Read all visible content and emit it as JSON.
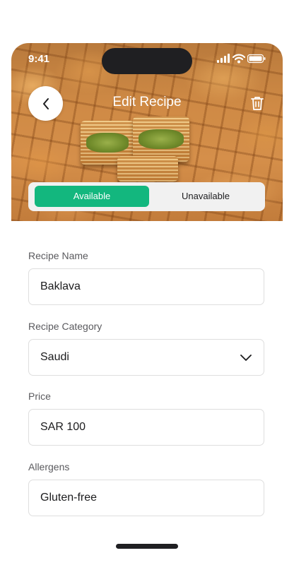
{
  "status_bar": {
    "time": "9:41"
  },
  "header": {
    "title": "Edit Recipe"
  },
  "availability": {
    "options": [
      "Available",
      "Unavailable"
    ],
    "selected": "Available",
    "accent_color": "#13b77e"
  },
  "form": {
    "recipe_name": {
      "label": "Recipe Name",
      "value": "Baklava"
    },
    "recipe_category": {
      "label": "Recipe Category",
      "value": "Saudi"
    },
    "price": {
      "label": "Price",
      "value": "SAR 100"
    },
    "allergens": {
      "label": "Allergens",
      "value": "Gluten-free"
    }
  },
  "icons": {
    "back": "chevron-left-icon",
    "delete": "trash-icon",
    "dropdown": "chevron-down-icon",
    "signal": "signal-icon",
    "wifi": "wifi-icon",
    "battery": "battery-icon"
  }
}
